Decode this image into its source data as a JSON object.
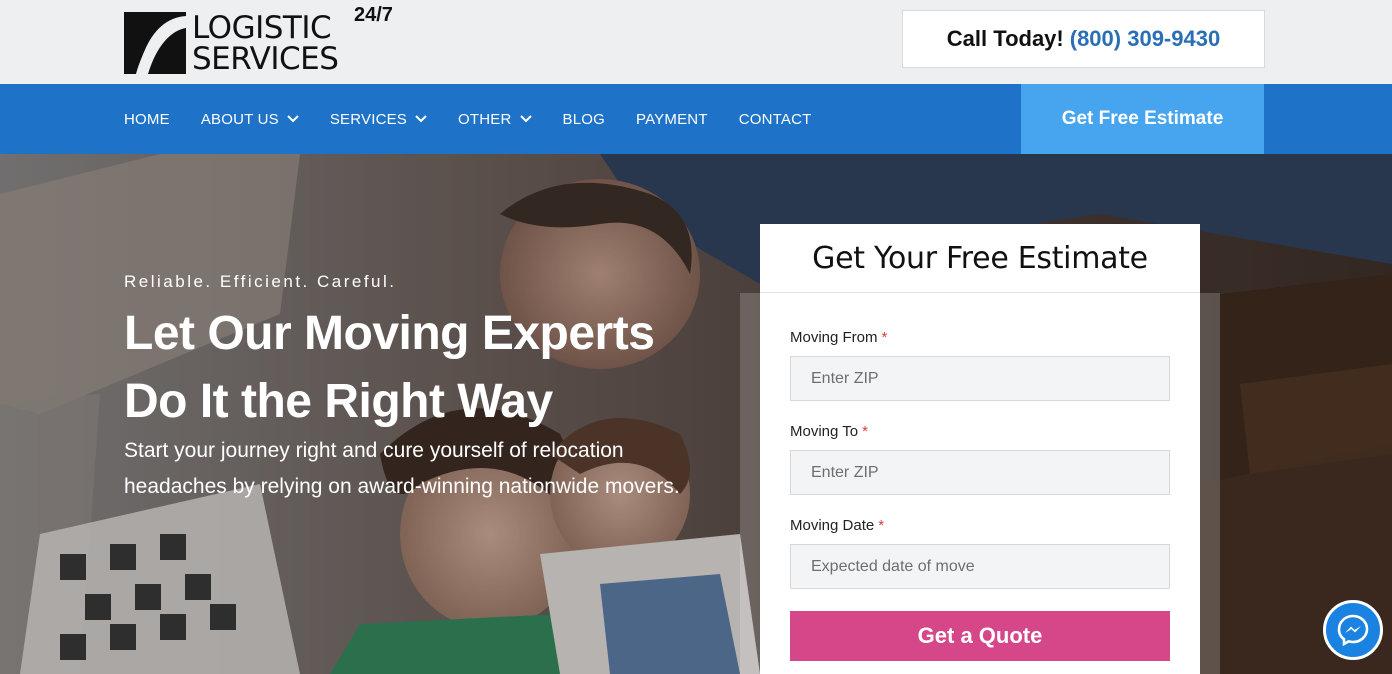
{
  "logo": {
    "line1": "LOGISTIC",
    "line2": "SERVICES",
    "sup": "24/7"
  },
  "header": {
    "call_label": "Call Today!",
    "call_phone": "(800) 309-9430"
  },
  "nav": {
    "items": [
      {
        "label": "HOME",
        "dropdown": false
      },
      {
        "label": "ABOUT US",
        "dropdown": true
      },
      {
        "label": "SERVICES",
        "dropdown": true
      },
      {
        "label": "OTHER",
        "dropdown": true
      },
      {
        "label": "BLOG",
        "dropdown": false
      },
      {
        "label": "PAYMENT",
        "dropdown": false
      },
      {
        "label": "CONTACT",
        "dropdown": false
      }
    ],
    "cta_label": "Get Free Estimate"
  },
  "hero": {
    "tagline": "Reliable. Efficient. Careful.",
    "headline_line1": "Let Our Moving Experts",
    "headline_line2": "Do It the Right Way",
    "subtext": "Start your journey right and cure yourself of relocation headaches by relying on award-winning nationwide movers."
  },
  "form": {
    "title": "Get Your Free Estimate",
    "fields": [
      {
        "label": "Moving From",
        "required_mark": "*",
        "placeholder": "Enter ZIP"
      },
      {
        "label": "Moving To",
        "required_mark": "*",
        "placeholder": "Enter ZIP"
      },
      {
        "label": "Moving Date",
        "required_mark": "*",
        "placeholder": "Expected date of move"
      }
    ],
    "submit_label": "Get a Quote"
  },
  "colors": {
    "nav_bg": "#1e73c8",
    "cta_bg": "#47a5f0",
    "phone": "#2a6fb5",
    "quote_button": "#d6478a",
    "messenger": "#1a82e0"
  },
  "icons": {
    "messenger": "messenger-icon",
    "dropdown": "chevron-down-icon"
  }
}
